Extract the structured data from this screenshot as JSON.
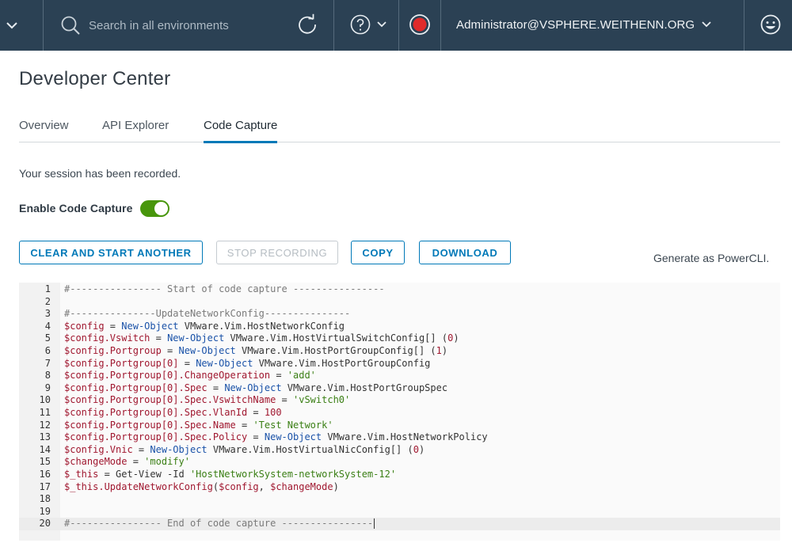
{
  "header": {
    "search_placeholder": "Search in all environments",
    "user": "Administrator@VSPHERE.WEITHENN.ORG",
    "bg_color": "#2b4154",
    "record_color": "#e02b2b"
  },
  "page": {
    "title": "Developer Center",
    "tabs": [
      {
        "label": "Overview",
        "active": false
      },
      {
        "label": "API Explorer",
        "active": false
      },
      {
        "label": "Code Capture",
        "active": true
      }
    ],
    "session_message": "Your session has been recorded.",
    "toggle_label": "Enable Code Capture",
    "toggle_on": true,
    "buttons": {
      "clear": "CLEAR AND START ANOTHER",
      "stop": "STOP RECORDING",
      "copy": "COPY",
      "download": "DOWNLOAD"
    },
    "generate_note": "Generate as PowerCLI."
  },
  "code": {
    "lines": [
      {
        "n": "1",
        "text": "#---------------- Start of code capture ----------------"
      },
      {
        "n": "2",
        "text": ""
      },
      {
        "n": "3",
        "text": "#---------------UpdateNetworkConfig---------------"
      },
      {
        "n": "4",
        "text": "$config = New-Object VMware.Vim.HostNetworkConfig"
      },
      {
        "n": "5",
        "text": "$config.Vswitch = New-Object VMware.Vim.HostVirtualSwitchConfig[] (0)"
      },
      {
        "n": "6",
        "text": "$config.Portgroup = New-Object VMware.Vim.HostPortGroupConfig[] (1)"
      },
      {
        "n": "7",
        "text": "$config.Portgroup[0] = New-Object VMware.Vim.HostPortGroupConfig"
      },
      {
        "n": "8",
        "text": "$config.Portgroup[0].ChangeOperation = 'add'"
      },
      {
        "n": "9",
        "text": "$config.Portgroup[0].Spec = New-Object VMware.Vim.HostPortGroupSpec"
      },
      {
        "n": "10",
        "text": "$config.Portgroup[0].Spec.VswitchName = 'vSwitch0'"
      },
      {
        "n": "11",
        "text": "$config.Portgroup[0].Spec.VlanId = 100"
      },
      {
        "n": "12",
        "text": "$config.Portgroup[0].Spec.Name = 'Test Network'"
      },
      {
        "n": "13",
        "text": "$config.Portgroup[0].Spec.Policy = New-Object VMware.Vim.HostNetworkPolicy"
      },
      {
        "n": "14",
        "text": "$config.Vnic = New-Object VMware.Vim.HostVirtualNicConfig[] (0)"
      },
      {
        "n": "15",
        "text": "$changeMode = 'modify'"
      },
      {
        "n": "16",
        "text": "$_this = Get-View -Id 'HostNetworkSystem-networkSystem-12'"
      },
      {
        "n": "17",
        "text": "$_this.UpdateNetworkConfig($config, $changeMode)"
      },
      {
        "n": "18",
        "text": ""
      },
      {
        "n": "19",
        "text": ""
      },
      {
        "n": "20",
        "text": "#---------------- End of code capture ----------------"
      }
    ],
    "current_line": "20"
  }
}
